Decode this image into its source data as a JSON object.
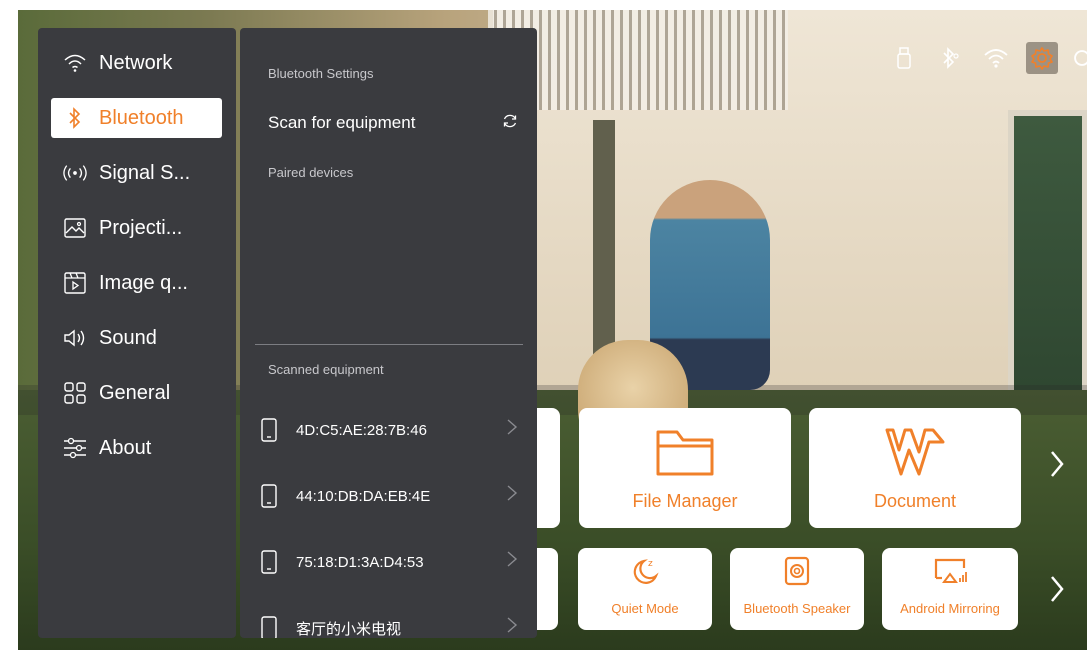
{
  "status_bar": {
    "icons": [
      "usb-icon",
      "bluetooth-icon",
      "wifi-icon",
      "settings-gear-icon",
      "power-icon"
    ],
    "accent": "#f0802a"
  },
  "menu": {
    "items": [
      {
        "label": "Network",
        "icon": "wifi-icon"
      },
      {
        "label": "Bluetooth",
        "icon": "bluetooth-icon",
        "active": true
      },
      {
        "label": "Signal S...",
        "icon": "signal-icon"
      },
      {
        "label": "Projecti...",
        "icon": "image-frame-icon"
      },
      {
        "label": "Image q...",
        "icon": "film-icon"
      },
      {
        "label": "Sound",
        "icon": "speaker-icon"
      },
      {
        "label": "General",
        "icon": "grid-icon"
      },
      {
        "label": "About",
        "icon": "sliders-icon"
      }
    ]
  },
  "bluetooth": {
    "section_title": "Bluetooth Settings",
    "scan_label": "Scan for equipment",
    "paired_title": "Paired devices",
    "scanned_title": "Scanned equipment",
    "devices": [
      {
        "name": "4D:C5:AE:28:7B:46"
      },
      {
        "name": "44:10:DB:DA:EB:4E"
      },
      {
        "name": "75:18:D1:3A:D4:53"
      },
      {
        "name": "客厅的小米电视"
      }
    ]
  },
  "apps": {
    "large": [
      {
        "label": "File Manager",
        "icon": "folder-icon"
      },
      {
        "label": "Document",
        "icon": "wps-icon"
      }
    ],
    "small": [
      {
        "label": "Quiet Mode",
        "icon": "moon-icon"
      },
      {
        "label": "Bluetooth Speaker",
        "icon": "speaker-box-icon"
      },
      {
        "label": "Android Mirroring",
        "icon": "mirroring-icon"
      }
    ]
  },
  "colors": {
    "accent": "#f0802a",
    "panel_bg": "#3a3b3f"
  }
}
